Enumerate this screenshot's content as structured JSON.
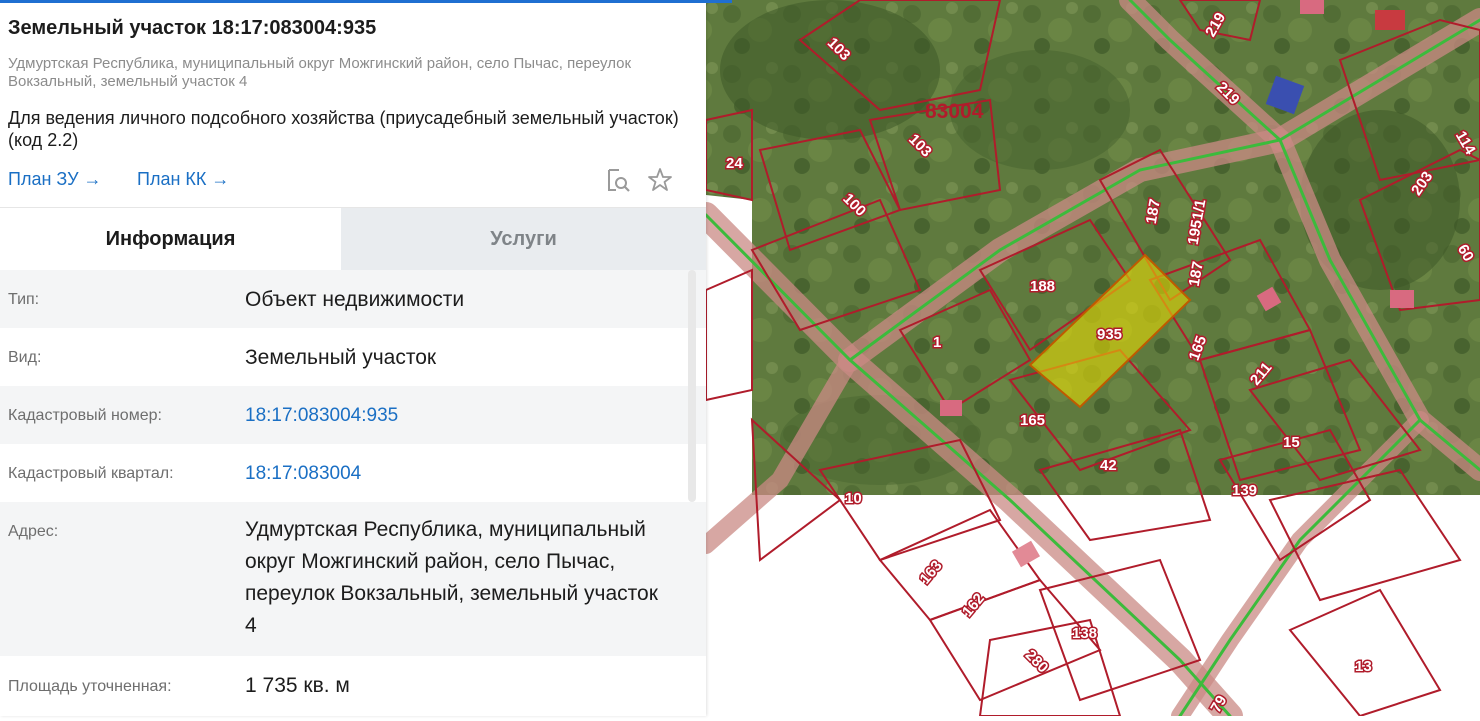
{
  "header": {
    "title": "Земельный участок 18:17:083004:935",
    "address": "Удмуртская Республика, муниципальный округ Можгинский район, село Пычас, переулок Вокзальный, земельный участок 4",
    "purpose": "Для ведения личного подсобного хозяйства (приусадебный земельный участок) (код 2.2)",
    "plan_zu": "План ЗУ →",
    "plan_kk": "План КК →",
    "icons": [
      "search-document-icon",
      "star-icon"
    ]
  },
  "tabs": [
    {
      "label": "Информация",
      "active": true
    },
    {
      "label": "Услуги",
      "active": false
    }
  ],
  "info": {
    "rows": [
      {
        "label": "Тип:",
        "value": "Объект недвижимости"
      },
      {
        "label": "Вид:",
        "value": "Земельный участок"
      },
      {
        "label": "Кадастровый номер:",
        "value": "18:17:083004:935"
      },
      {
        "label": "Кадастровый квартал:",
        "value": "18:17:083004"
      },
      {
        "label": "Адрес:",
        "value": "Удмуртская Республика, муниципальный округ Можгинский район, село Пычас, переулок Вокзальный, земельный участок 4"
      },
      {
        "label": "Площадь уточненная:",
        "value": "1 735 кв. м"
      }
    ]
  },
  "map": {
    "quarter_label": "83004",
    "selected_parcel_label": "935",
    "parcel_labels": [
      "103",
      "103",
      "100",
      "219",
      "219",
      "24",
      "187",
      "1951/1",
      "187",
      "188",
      "1",
      "165",
      "165",
      "211",
      "203",
      "114",
      "60",
      "15",
      "42",
      "139",
      "10",
      "163",
      "162",
      "138",
      "280",
      "13",
      "79"
    ],
    "colors": {
      "boundary": "#b01c2b",
      "selected_fill": "#f3e300",
      "selected_stroke": "#c05a00",
      "road": "#3cbb3c"
    }
  }
}
